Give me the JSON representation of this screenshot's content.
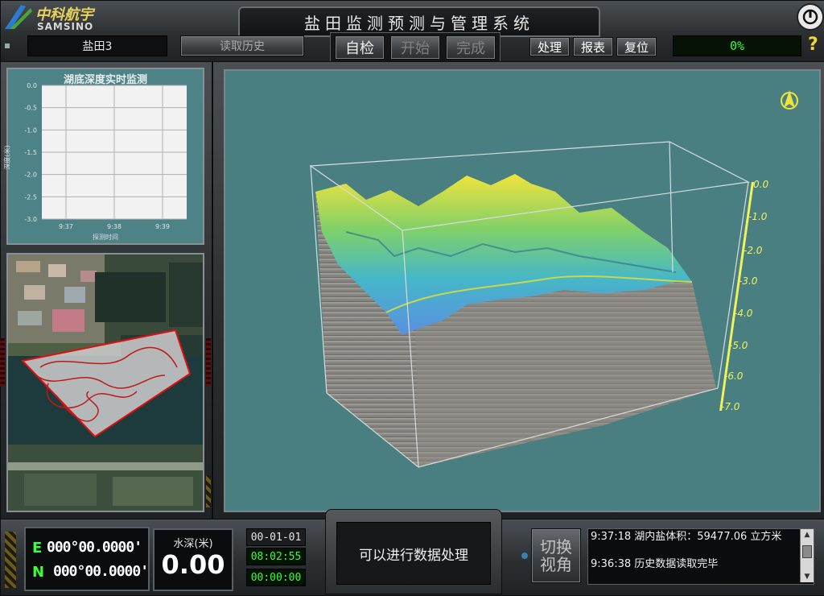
{
  "brand": {
    "name": "中科航宇",
    "sub": "SAMSINO"
  },
  "app": {
    "title": "盐田监测预测与管理系统"
  },
  "toolbar": {
    "site": "盐田3",
    "history": "读取历史",
    "self_check": "自检",
    "start": "开始",
    "finish": "完成",
    "process": "处理",
    "report": "报表",
    "reset": "复位",
    "progress": "0%"
  },
  "depth_chart": {
    "title": "湖底深度实时监测",
    "ylabel": "深度(米)",
    "xlabel": "探测时间",
    "yticks": [
      "0.0",
      "-0.5",
      "-1.0",
      "-1.5",
      "-2.0",
      "-2.5",
      "-3.0"
    ],
    "xticks": [
      "9:37",
      "9:38",
      "9:39"
    ]
  },
  "chart_data": {
    "type": "line",
    "title": "湖底深度实时监测",
    "xlabel": "探测时间",
    "ylabel": "深度(米)",
    "categories": [
      "9:37",
      "9:38",
      "9:39"
    ],
    "ylim": [
      -3.0,
      0.0
    ],
    "series": [],
    "grid": true
  },
  "view3d": {
    "scale": [
      "0.0",
      "-1.0",
      "-2.0",
      "-3.0",
      "-4.0",
      "-5.0",
      "-6.0",
      "-7.0"
    ]
  },
  "status": {
    "east": "000°00.0000'",
    "north": "000°00.0000'",
    "e_label": "E",
    "n_label": "N",
    "depth_label": "水深(米)",
    "depth_value": "0.00",
    "date": "00-01-01",
    "time": "08:02:55",
    "elapsed": "00:00:00",
    "message": "可以进行数据处理",
    "switch_view": "切换\n视角",
    "log": [
      "9:37:18 湖内盐体积：59477.06 立方米",
      "9:36:38 历史数据读取完毕"
    ]
  },
  "colors": {
    "teal_panel": "#4d8287",
    "lcd_green": "#38ff38",
    "yellow_scale": "#f2f25a"
  }
}
